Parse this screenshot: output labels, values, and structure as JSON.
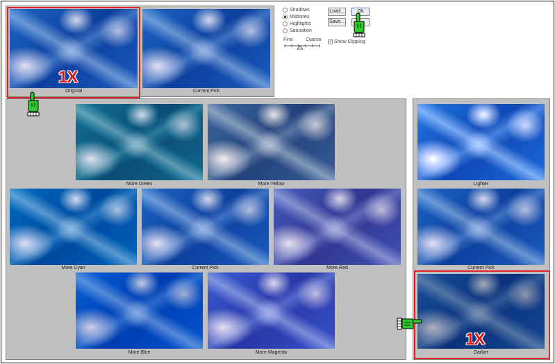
{
  "top_thumbs": {
    "original": "Original",
    "current_pick": "Current Pick"
  },
  "controls": {
    "radios": [
      {
        "label": "Shadows",
        "checked": false
      },
      {
        "label": "Midtones",
        "checked": true
      },
      {
        "label": "Highlights",
        "checked": false
      },
      {
        "label": "Saturation",
        "checked": false
      }
    ],
    "buttons": {
      "load": "Load...",
      "ok": "Ok",
      "save": "Save..."
    },
    "slider": {
      "fine": "Fine",
      "coarse": "Coarse"
    },
    "show_clipping": {
      "label": "Show Clipping",
      "checked": true
    }
  },
  "variations": {
    "more_green": "More Green",
    "more_yellow": "More Yellow",
    "more_cyan": "More Cyan",
    "current_pick": "Current Pick",
    "more_red": "More Red",
    "more_blue": "More Blue",
    "more_magenta": "More Magenta"
  },
  "brightness": {
    "lighter": "Lighter",
    "current_pick": "Current Pick",
    "darker": "Darker"
  },
  "annotations": {
    "onex_top": "1X",
    "onex_bottom": "1X"
  },
  "colors": {
    "highlight": "#e2252d",
    "hand": "#2ec92e",
    "panel": "#c0c0c0"
  }
}
